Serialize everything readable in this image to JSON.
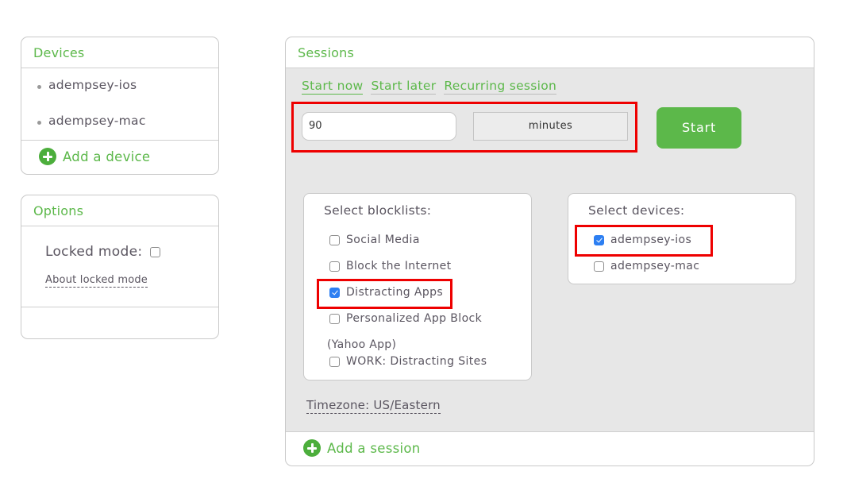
{
  "devices_panel": {
    "title": "Devices",
    "items": [
      "adempsey-ios",
      "adempsey-mac"
    ],
    "add_label": "Add a device"
  },
  "options_panel": {
    "title": "Options",
    "locked_mode_label": "Locked mode:",
    "locked_mode_checked": false,
    "about_link": "About locked mode"
  },
  "sessions_panel": {
    "title": "Sessions",
    "tabs": [
      {
        "label": "Start now",
        "active": true
      },
      {
        "label": "Start later",
        "active": false
      },
      {
        "label": "Recurring session",
        "active": false
      }
    ],
    "duration_value": "90",
    "duration_unit": "minutes",
    "start_label": "Start",
    "blocklists": {
      "title": "Select blocklists:",
      "items": [
        {
          "label": "Social Media",
          "checked": false
        },
        {
          "label": "Block the Internet",
          "checked": false
        },
        {
          "label": "Distracting Apps",
          "checked": true
        },
        {
          "label": "Personalized App Block",
          "checked": false
        },
        {
          "label": "WORK: Distracting Sites",
          "checked": false
        }
      ],
      "wrapped_text": "(Yahoo App)"
    },
    "devices": {
      "title": "Select devices:",
      "items": [
        {
          "label": "adempsey-ios",
          "checked": true
        },
        {
          "label": "adempsey-mac",
          "checked": false
        }
      ]
    },
    "timezone": "Timezone: US/Eastern",
    "add_label": "Add a session"
  },
  "colors": {
    "accent_green": "#5cb84a",
    "highlight_red": "#ee0000",
    "checkbox_blue": "#2d7ff2"
  }
}
